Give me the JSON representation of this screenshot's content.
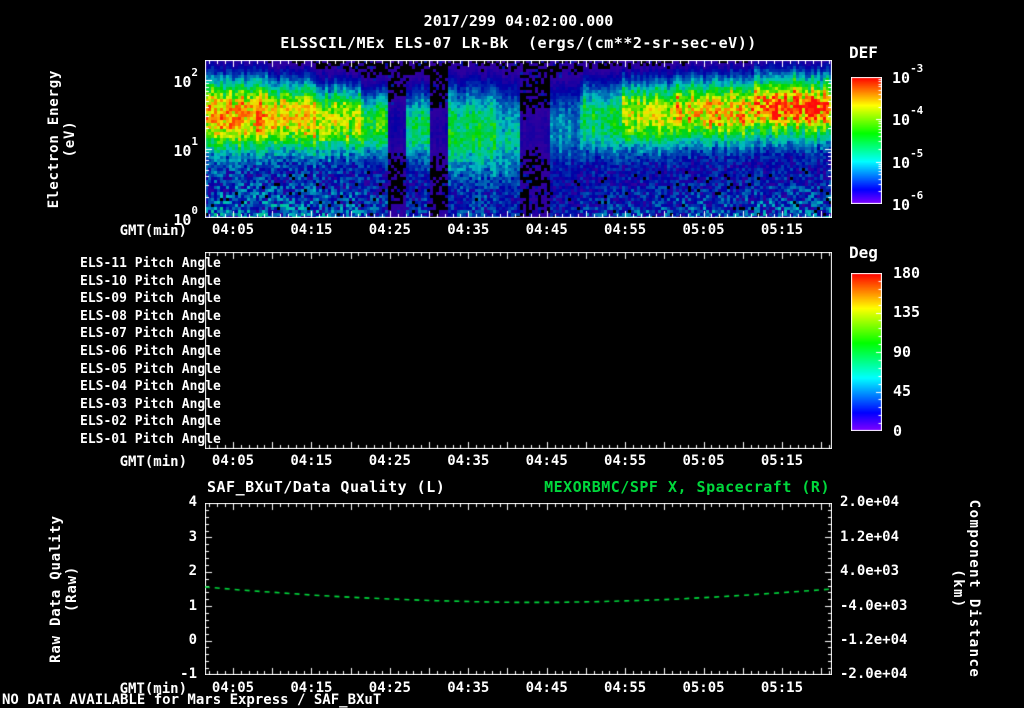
{
  "title_line": "2017/299 04:02:00.000",
  "subtitle": "ELSSCIL/MEx ELS-07 LR-Bk  (ergs/(cm**2-sr-sec-eV))",
  "footer": {
    "no_data": "NO DATA AVAILABLE for Mars Express / SAF_BXuT"
  },
  "colors": {
    "background": "#000000",
    "text": "#ffffff",
    "green": "#00d93c",
    "frame": "#ffffff"
  },
  "time_axis": {
    "label": "GMT(min)",
    "start": "04:02",
    "end": "05:21",
    "tick_labels": [
      "04:05",
      "04:15",
      "04:25",
      "04:35",
      "04:45",
      "04:55",
      "05:05",
      "05:15"
    ],
    "tick_minutes": [
      5,
      15,
      25,
      35,
      45,
      55,
      65,
      75
    ]
  },
  "panels": {
    "spectrogram": {
      "ylabel1": "Electron Energy",
      "ylabel2": "(eV)",
      "y_ticks": [
        {
          "b": "10",
          "e": "2"
        },
        {
          "b": "10",
          "e": "1"
        },
        {
          "b": "10",
          "e": "0"
        }
      ],
      "colorbar_title": "DEF",
      "colorbar_ticks": [
        {
          "b": "10",
          "e": "-3"
        },
        {
          "b": "10",
          "e": "-4"
        },
        {
          "b": "10",
          "e": "-5"
        },
        {
          "b": "10",
          "e": "-6"
        }
      ]
    },
    "pitch": {
      "row_labels": [
        "ELS-11 Pitch Angle",
        "ELS-10 Pitch Angle",
        "ELS-09 Pitch Angle",
        "ELS-08 Pitch Angle",
        "ELS-07 Pitch Angle",
        "ELS-06 Pitch Angle",
        "ELS-05 Pitch Angle",
        "ELS-04 Pitch Angle",
        "ELS-03 Pitch Angle",
        "ELS-02 Pitch Angle",
        "ELS-01 Pitch Angle"
      ],
      "colorbar_title": "Deg",
      "colorbar_ticks": [
        "180",
        "135",
        "90",
        "45",
        "0"
      ]
    },
    "timeseries": {
      "title_left": "SAF_BXuT/Data Quality (L)",
      "title_right": "MEXORBMC/SPF X, Spacecraft (R)",
      "ylabel_left1": "Raw Data Quality",
      "ylabel_left2": "(Raw)",
      "ylabel_right1": "Component Distance",
      "ylabel_right2": "(km)",
      "left_ticks": [
        "4",
        "3",
        "2",
        "1",
        "0",
        "-1"
      ],
      "right_ticks": [
        "2.0e+04",
        "1.2e+04",
        "4.0e+03",
        "-4.0e+03",
        "-1.2e+04",
        "-2.0e+04"
      ]
    }
  },
  "chart_data": [
    {
      "type": "heatmap",
      "title": "ELSSCIL/MEx ELS-07 LR-Bk electron energy spectrogram",
      "x_range_time": [
        "04:02",
        "05:21"
      ],
      "x_range_minutes_after_0400": [
        1.43,
        81.38
      ],
      "ylabel": "Electron Energy (eV)",
      "y_scale": "log",
      "y_range_eV": [
        1,
        195
      ],
      "z_units": "ergs/(cm**2-sr-sec-eV)",
      "z_scale": "log",
      "z_range": [
        1e-06,
        0.001
      ],
      "legend_position": "right-colorbar",
      "description": "Bright flux band 10-60 eV at start (yellow-green), fading with two black data gaps near 04:26 and 04:31, weak diffuse cyan until a black gap near 04:42-04:46, then band returns after ~04:48 strengthening to yellow/orange-red 30-60 eV toward 05:20; blue noise floor below 10 eV throughout",
      "phases": [
        {
          "t0": 0.0,
          "t1": 8.0,
          "amp": 0.95,
          "center": 1.5,
          "width": 0.34,
          "floor": 0.3,
          "vmax": 0.92
        },
        {
          "t0": 8.0,
          "t1": 14.0,
          "amp": 0.88,
          "center": 1.46,
          "width": 0.32,
          "floor": 0.3,
          "vmax": 0.85
        },
        {
          "t0": 14.0,
          "t1": 20.0,
          "amp": 0.8,
          "center": 1.42,
          "width": 0.3,
          "floor": 0.28,
          "vmax": 0.8
        },
        {
          "t0": 20.0,
          "t1": 23.5,
          "amp": 0.6,
          "center": 1.4,
          "width": 0.3,
          "floor": 0.24,
          "vmax": 0.7
        },
        {
          "t0": 23.5,
          "t1": 25.5,
          "amp": 0.1,
          "center": 1.35,
          "width": 0.3,
          "floor": 0.05,
          "vmax": 0.5
        },
        {
          "t0": 25.5,
          "t1": 28.5,
          "amp": 0.45,
          "center": 1.35,
          "width": 0.34,
          "floor": 0.2,
          "vmax": 0.6
        },
        {
          "t0": 28.5,
          "t1": 31.0,
          "amp": 0.08,
          "center": 1.3,
          "width": 0.3,
          "floor": 0.05,
          "vmax": 0.5
        },
        {
          "t0": 31.0,
          "t1": 37.0,
          "amp": 0.48,
          "center": 1.3,
          "width": 0.42,
          "floor": 0.2,
          "vmax": 0.62
        },
        {
          "t0": 37.0,
          "t1": 40.0,
          "amp": 0.36,
          "center": 1.25,
          "width": 0.45,
          "floor": 0.16,
          "vmax": 0.55
        },
        {
          "t0": 40.0,
          "t1": 44.0,
          "amp": 0.07,
          "center": 1.3,
          "width": 0.3,
          "floor": 0.05,
          "vmax": 0.4
        },
        {
          "t0": 44.0,
          "t1": 48.0,
          "amp": 0.28,
          "center": 1.35,
          "width": 0.38,
          "floor": 0.16,
          "vmax": 0.5
        },
        {
          "t0": 48.0,
          "t1": 53.0,
          "amp": 0.5,
          "center": 1.45,
          "width": 0.34,
          "floor": 0.2,
          "vmax": 0.65
        },
        {
          "t0": 53.0,
          "t1": 60.0,
          "amp": 0.75,
          "center": 1.5,
          "width": 0.31,
          "floor": 0.22,
          "vmax": 0.8
        },
        {
          "t0": 60.0,
          "t1": 70.0,
          "amp": 0.88,
          "center": 1.55,
          "width": 0.3,
          "floor": 0.24,
          "vmax": 0.93
        },
        {
          "t0": 70.0,
          "t1": 80.5,
          "amp": 0.95,
          "center": 1.6,
          "width": 0.3,
          "floor": 0.26,
          "vmax": 1.05
        }
      ]
    },
    {
      "type": "heatmap",
      "title": "ELS-01..ELS-11 Pitch Angle panel",
      "ylabel": "Pitch Angle (Deg)",
      "y_range_deg": [
        0,
        180
      ],
      "values": "no data (panel empty/black)"
    },
    {
      "type": "line",
      "name": "MEXORBMC/SPF X, Spacecraft (R)",
      "style": "dashed",
      "color": "#00d93c",
      "x_label": "GMT(min)",
      "x_minutes_after_0400": [
        1.4,
        6,
        11,
        16,
        21,
        26,
        31,
        36,
        41,
        46,
        51,
        56,
        61,
        66,
        71,
        76,
        81.4
      ],
      "y_left_axis": [
        1.56,
        1.47,
        1.39,
        1.31,
        1.25,
        1.2,
        1.16,
        1.13,
        1.11,
        1.11,
        1.13,
        1.16,
        1.2,
        1.26,
        1.33,
        1.41,
        1.5
      ],
      "y_km_right_axis": [
        480,
        -240,
        -880,
        -1520,
        -2000,
        -2400,
        -2720,
        -2960,
        -3120,
        -3120,
        -2960,
        -2720,
        -2400,
        -1920,
        -1360,
        -720,
        0
      ],
      "left_axis_range": [
        -1,
        4
      ],
      "right_axis_range": [
        -20000,
        20000
      ],
      "note": "SAF_BXuT/Data Quality (L) series absent - NO DATA AVAILABLE"
    }
  ]
}
